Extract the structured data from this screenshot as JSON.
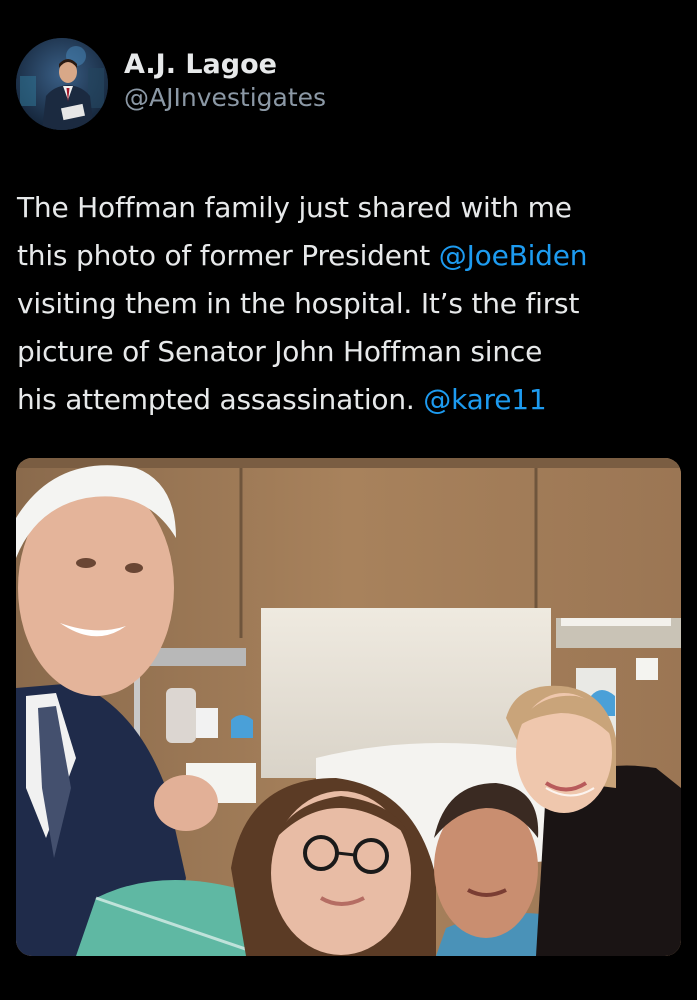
{
  "tweet": {
    "display_name": "A.J. Lagoe",
    "handle": "@AJInvestigates",
    "text_lines": [
      {
        "pre": "The Hoffman family just shared with me",
        "mention": "",
        "post": ""
      },
      {
        "pre": "this photo of former President ",
        "mention": "@JoeBiden",
        "post": ""
      },
      {
        "pre": "visiting them in the hospital. It’s the first",
        "mention": "",
        "post": ""
      },
      {
        "pre": "picture of  Senator John Hoffman since",
        "mention": "",
        "post": ""
      },
      {
        "pre": "his attempted assassination. ",
        "mention": "@kare11",
        "post": ""
      }
    ]
  },
  "colors": {
    "background": "#000000",
    "primary_text": "#e7e9ea",
    "secondary_text": "#8b98a5",
    "mention": "#1d9bf0"
  },
  "icons": {
    "avatar": "profile-photo",
    "media": "hospital-selfie-photo"
  }
}
